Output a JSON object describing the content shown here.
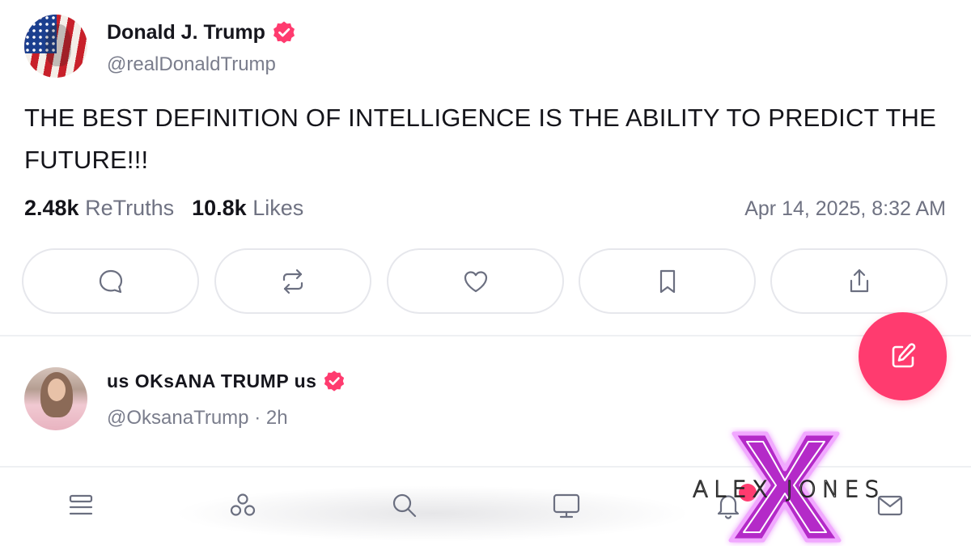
{
  "post": {
    "author": {
      "display_name": "Donald J. Trump",
      "handle": "@realDonaldTrump",
      "verified": true
    },
    "text": "THE BEST DEFINITION OF INTELLIGENCE IS THE ABILITY TO PREDICT THE FUTURE!!!",
    "stats": {
      "retruths_count": "2.48k",
      "retruths_label": "ReTruths",
      "likes_count": "10.8k",
      "likes_label": "Likes"
    },
    "timestamp": "Apr 14, 2025, 8:32 AM",
    "actions": [
      {
        "icon": "reply-icon"
      },
      {
        "icon": "retruth-icon"
      },
      {
        "icon": "heart-icon"
      },
      {
        "icon": "bookmark-icon"
      },
      {
        "icon": "share-icon"
      }
    ]
  },
  "next_post": {
    "author": {
      "display_name": "us OKsANA TRUMP us",
      "handle": "@OksanaTrump · 2h",
      "verified": true
    }
  },
  "compose_button": {
    "icon": "compose-icon"
  },
  "bottom_nav": {
    "items": [
      {
        "icon": "feed-icon"
      },
      {
        "icon": "groups-icon"
      },
      {
        "icon": "search-icon"
      },
      {
        "icon": "tv-icon"
      },
      {
        "icon": "bell-icon"
      },
      {
        "icon": "mail-icon"
      }
    ]
  },
  "watermark": {
    "text": "ALEX JONES"
  },
  "colors": {
    "accent": "#ff3b6f",
    "badge": "#ff3b6f",
    "muted_text": "#6f7282",
    "border": "#e6e7ec",
    "watermark_glow": "#d23cff"
  }
}
